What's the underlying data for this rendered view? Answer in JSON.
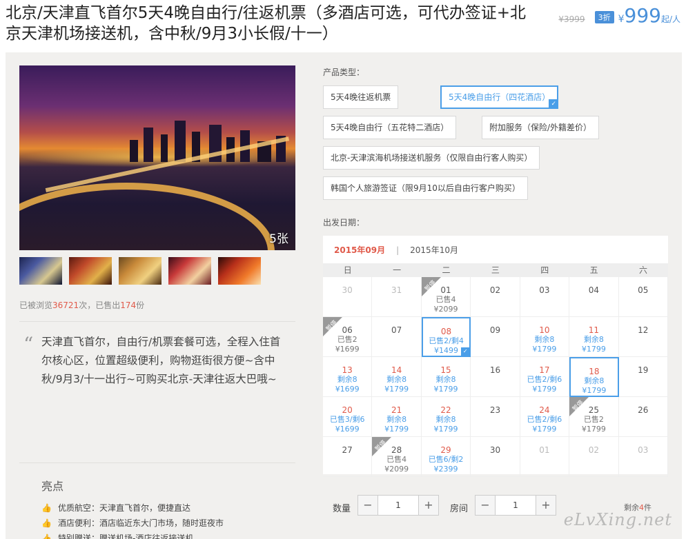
{
  "header": {
    "title": "北京/天津直飞首尔5天4晚自由行/往返机票（多酒店可选，可代办签证+北京天津机场接送机，含中秋/9月3小长假/十一）",
    "price_old": "¥3999",
    "discount": "3折",
    "price_yen": "¥",
    "price_value": "999",
    "price_suffix": "起/人"
  },
  "gallery": {
    "photo_count": "5张",
    "thumbnails": [
      "thumb-1",
      "thumb-2",
      "thumb-3",
      "thumb-4",
      "thumb-5"
    ]
  },
  "stats": {
    "prefix": "已被浏览",
    "views": "36721",
    "mid": "次，已售出",
    "sold": "174",
    "suffix": "份"
  },
  "quote": {
    "mark": "“",
    "text": "天津直飞首尔，自由行/机票套餐可选，全程入住首尔核心区，位置超级便利，购物逛街很方便~含中秋/9月3/十一出行~可购买北京-天津往返大巴哦~"
  },
  "highlights": {
    "title": "亮点",
    "items": [
      "优质航空：天津直飞首尔，便捷直达",
      "酒店便利：酒店临近东大门市场，随时逛夜市",
      "特别赠送：赠送机场-酒店往返接送机"
    ]
  },
  "product_type": {
    "label": "产品类型：",
    "options": [
      {
        "label": "5天4晚往返机票",
        "selected": false
      },
      {
        "label": "5天4晚自由行（四花酒店）",
        "selected": true
      },
      {
        "label": "5天4晚自由行（五花特二酒店）",
        "selected": false
      },
      {
        "label": "附加服务（保险/外籍差价）",
        "selected": false
      },
      {
        "label": "北京-天津滨海机场接送机服务（仅限自由行客人购买）",
        "selected": false
      },
      {
        "label": "韩国个人旅游签证（限9月10以后自由行客户购买）",
        "selected": false
      }
    ]
  },
  "calendar": {
    "label": "出发日期：",
    "month_active": "2015年09月",
    "separator": "|",
    "month_other": "2015年10月",
    "weekdays": [
      "日",
      "一",
      "二",
      "三",
      "四",
      "五",
      "六"
    ],
    "tag_text": "暂停",
    "rows": [
      [
        {
          "d": "30",
          "k": "muted"
        },
        {
          "d": "31",
          "k": "muted"
        },
        {
          "d": "01",
          "k": "soldout",
          "s": "已售4",
          "p": "¥2099",
          "tag": true
        },
        {
          "d": "02"
        },
        {
          "d": "03"
        },
        {
          "d": "04"
        },
        {
          "d": "05"
        }
      ],
      [
        {
          "d": "06",
          "k": "soldout",
          "s": "已售2",
          "p": "¥1699",
          "tag": true
        },
        {
          "d": "07"
        },
        {
          "d": "08",
          "k": "avail picked check",
          "s": "已售2/剩4",
          "p": "¥1499"
        },
        {
          "d": "09"
        },
        {
          "d": "10",
          "k": "avail",
          "s": "剩余8",
          "p": "¥1799"
        },
        {
          "d": "11",
          "k": "avail",
          "s": "剩余8",
          "p": "¥1799"
        },
        {
          "d": "12"
        }
      ],
      [
        {
          "d": "13",
          "k": "avail",
          "s": "剩余8",
          "p": "¥1699"
        },
        {
          "d": "14",
          "k": "avail",
          "s": "剩余8",
          "p": "¥1799"
        },
        {
          "d": "15",
          "k": "avail",
          "s": "剩余8",
          "p": "¥1799"
        },
        {
          "d": "16"
        },
        {
          "d": "17",
          "k": "avail",
          "s": "已售2/剩6",
          "p": "¥1799"
        },
        {
          "d": "18",
          "k": "avail picked",
          "s": "剩余8",
          "p": "¥1799"
        },
        {
          "d": "19"
        }
      ],
      [
        {
          "d": "20",
          "k": "avail",
          "s": "已售3/剩6",
          "p": "¥1699"
        },
        {
          "d": "21",
          "k": "avail",
          "s": "剩余8",
          "p": "¥1799"
        },
        {
          "d": "22",
          "k": "avail",
          "s": "剩余8",
          "p": "¥1799"
        },
        {
          "d": "23"
        },
        {
          "d": "24",
          "k": "avail",
          "s": "已售2/剩6",
          "p": "¥1799"
        },
        {
          "d": "25",
          "k": "soldout",
          "s": "已售2",
          "p": "¥1799",
          "tag": true
        },
        {
          "d": "26"
        }
      ],
      [
        {
          "d": "27"
        },
        {
          "d": "28",
          "k": "soldout",
          "s": "已售4",
          "p": "¥2099",
          "tag": true
        },
        {
          "d": "29",
          "k": "avail",
          "s": "已售6/剩2",
          "p": "¥2399"
        },
        {
          "d": "30"
        },
        {
          "d": "01",
          "k": "muted"
        },
        {
          "d": "02",
          "k": "muted"
        },
        {
          "d": "03",
          "k": "muted"
        }
      ]
    ]
  },
  "order": {
    "qty_label": "数量",
    "qty_value": "1",
    "room_label": "房间",
    "room_value": "1",
    "minus": "−",
    "plus": "+",
    "remain_prefix": "剩余",
    "remain_count": "4",
    "remain_suffix": "件"
  },
  "watermark": "eLvXing.net",
  "colors": {
    "accent_blue": "#4a9ee8",
    "accent_red": "#e05a4a",
    "panel_bg": "#f1f0ee"
  }
}
